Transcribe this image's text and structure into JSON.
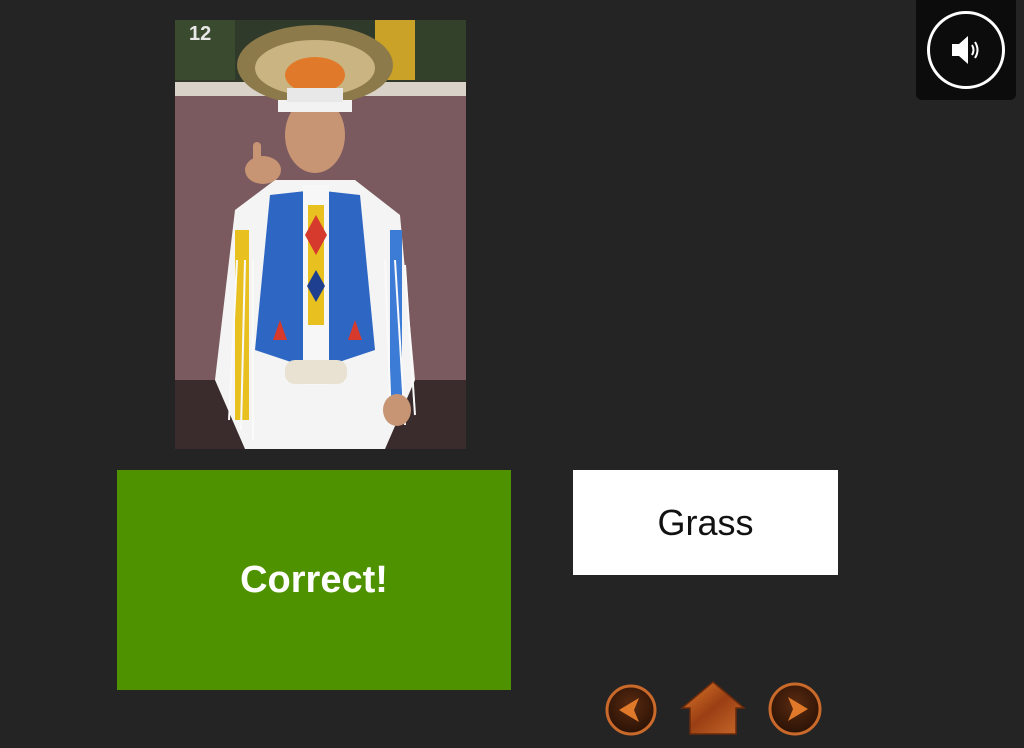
{
  "feedback": {
    "label": "Correct!",
    "color": "#4f9200"
  },
  "answer": {
    "label": "Grass"
  },
  "photo": {
    "subject": "pow-wow dancer in grass dance regalia",
    "jersey_number": "12"
  },
  "controls": {
    "audio_icon": "speaker-icon",
    "prev_icon": "arrow-left-icon",
    "home_icon": "home-icon",
    "next_icon": "arrow-right-icon",
    "accent_color": "#b8561f"
  }
}
